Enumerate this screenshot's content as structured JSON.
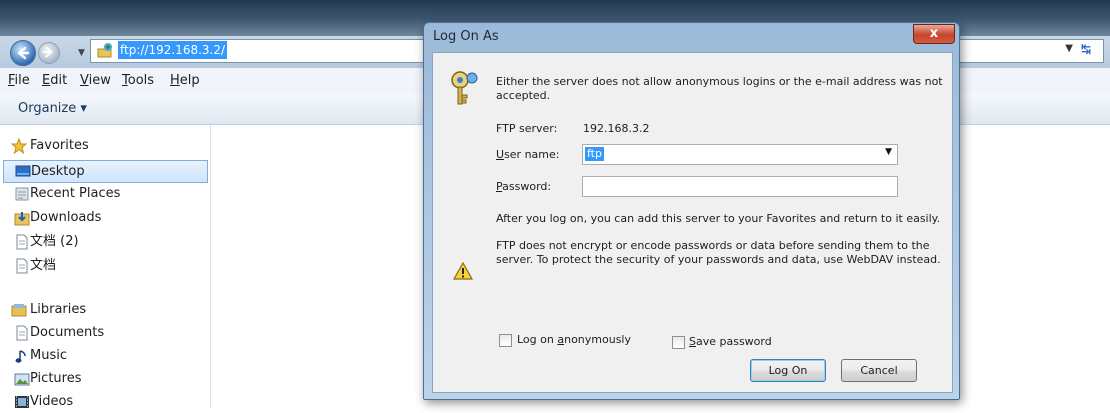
{
  "explorer": {
    "address": "ftp://192.168.3.2/",
    "menu": [
      {
        "pre": "",
        "key": "F",
        "post": "ile"
      },
      {
        "pre": "",
        "key": "E",
        "post": "dit"
      },
      {
        "pre": "",
        "key": "V",
        "post": "iew"
      },
      {
        "pre": "",
        "key": "T",
        "post": "ools"
      },
      {
        "pre": "",
        "key": "H",
        "post": "elp"
      }
    ],
    "organize_label": "Organize ▾",
    "nav": {
      "favorites": "Favorites",
      "desktop": "Desktop",
      "recent_places": "Recent Places",
      "downloads": "Downloads",
      "doc2": "文档 (2)",
      "doc": "文档",
      "libraries": "Libraries",
      "documents": "Documents",
      "music": "Music",
      "pictures": "Pictures",
      "videos": "Videos"
    }
  },
  "dialog": {
    "title": "Log On As",
    "close_glyph": "x",
    "message_line1": "Either the server does not allow anonymous logins or the e-mail address was not",
    "message_line2": "accepted.",
    "ftp_server_label": "FTP server:",
    "ftp_server_value": "192.168.3.2",
    "username_label_key": "U",
    "username_label_rest": "ser name:",
    "username_value": "ftp",
    "password_label_key": "P",
    "password_label_rest": "assword:",
    "password_value": "",
    "info_text": "After you log on, you can add this server to your Favorites and return to it easily.",
    "warning_line1": "FTP does not encrypt or encode passwords or data before sending them to the",
    "warning_line2": "server.  To protect the security of your passwords and data, use WebDAV instead.",
    "anon_pre": "Log on ",
    "anon_key": "a",
    "anon_post": "nonymously",
    "save_key": "S",
    "save_post": "ave password",
    "logon_button": "Log On",
    "cancel_button": "Cancel"
  },
  "colors": {
    "selection": "#3399ff",
    "dialog_frame": "#9bbad9",
    "close_button": "#c7442b"
  },
  "icons": [
    "back-arrow-icon",
    "forward-arrow-icon",
    "ftp-folder-icon",
    "refresh-icon",
    "star-icon",
    "desktop-icon",
    "recent-places-icon",
    "downloads-icon",
    "document-icon",
    "libraries-icon",
    "music-icon",
    "pictures-icon",
    "videos-icon",
    "key-icon",
    "warning-icon",
    "close-icon"
  ]
}
